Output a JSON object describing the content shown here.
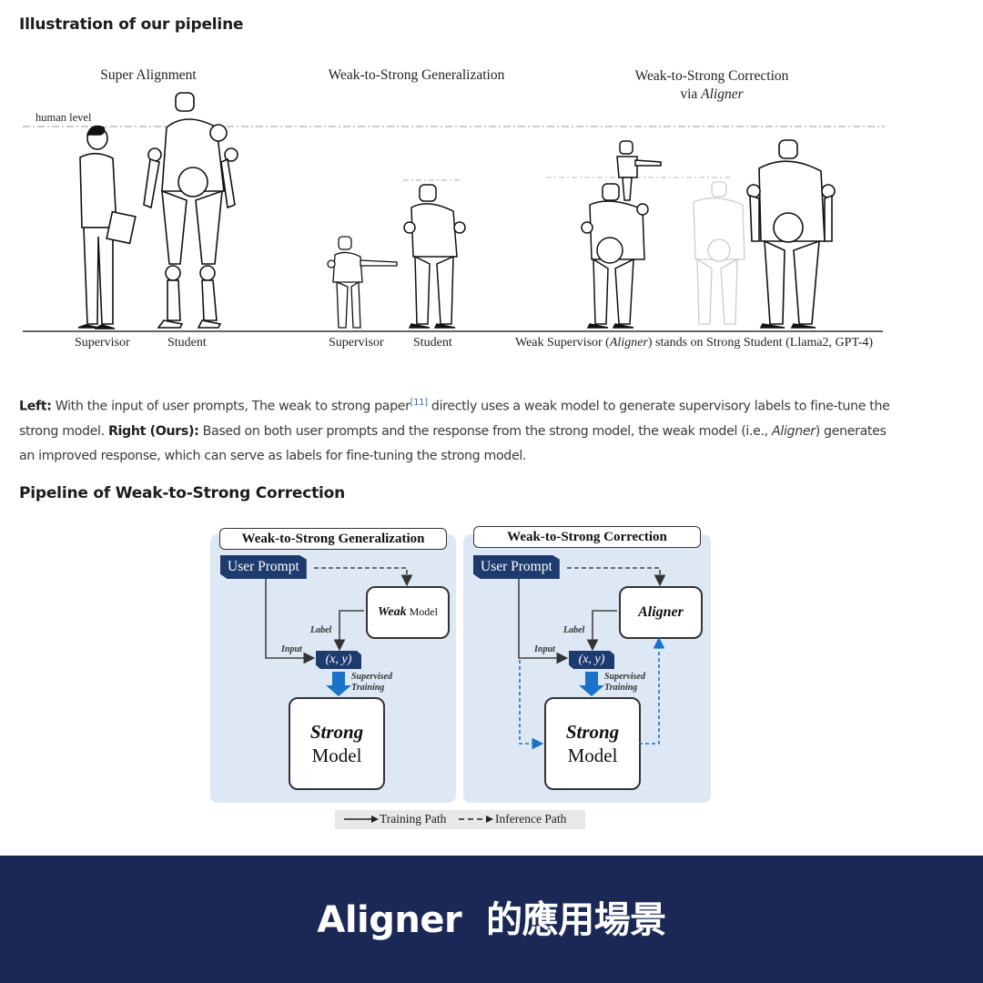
{
  "section1": {
    "heading": "Illustration of our pipeline",
    "figure": {
      "titles": {
        "super_alignment": "Super Alignment",
        "w2s_generalization": "Weak-to-Strong Generalization",
        "w2s_correction_line1": "Weak-to-Strong Correction",
        "w2s_correction_via": "via ",
        "w2s_correction_aligner": "Aligner"
      },
      "human_level_label": "human level",
      "captions": {
        "left_supervisor": "Supervisor",
        "left_student": "Student",
        "mid_supervisor": "Supervisor",
        "mid_student": "Student",
        "right_prefix": "Weak Supervisor (",
        "right_aligner": "Aligner",
        "right_suffix": ") stands on Strong Student  (Llama2, GPT-4)"
      }
    }
  },
  "description": {
    "left_label": "Left:",
    "left_text_1": " With the input of user prompts, The weak to strong paper",
    "citation": "[11]",
    "left_text_2": " directly uses a weak model to generate supervisory labels to fine-tune the strong model. ",
    "right_label": "Right (Ours):",
    "right_text_1": " Based on both user prompts and the response from the strong model, the weak model (i.e., ",
    "right_aligner": "Aligner",
    "right_text_2": ") generates an improved response, which can serve as labels for fine-tuning the strong model."
  },
  "section2": {
    "heading": "Pipeline of Weak-to-Strong Correction",
    "left_panel": {
      "title": "Weak-to-Strong Generalization",
      "prompt": "User Prompt",
      "model_bold": "Weak",
      "model_rest": " Model",
      "label": "Label",
      "input": "Input",
      "xy": "(x, y)",
      "supervised_1": "Supervised",
      "supervised_2": "Training",
      "strong_1": "Strong",
      "strong_2": "Model"
    },
    "right_panel": {
      "title": "Weak-to-Strong Correction",
      "prompt": "User Prompt",
      "model": "Aligner",
      "label": "Label",
      "input": "Input",
      "xy": "(x, y)",
      "supervised_1": "Supervised",
      "supervised_2": "Training",
      "strong_1": "Strong",
      "strong_2": "Model"
    },
    "legend": {
      "training": "Training Path",
      "inference": "Inference Path"
    },
    "colors": {
      "panel_bg": "#dde8f4",
      "navy": "#1d3b6e",
      "blue_arrow": "#1a73c8"
    }
  },
  "footer": {
    "title": "Aligner  的應用場景",
    "bg_color": "#1b2855"
  }
}
